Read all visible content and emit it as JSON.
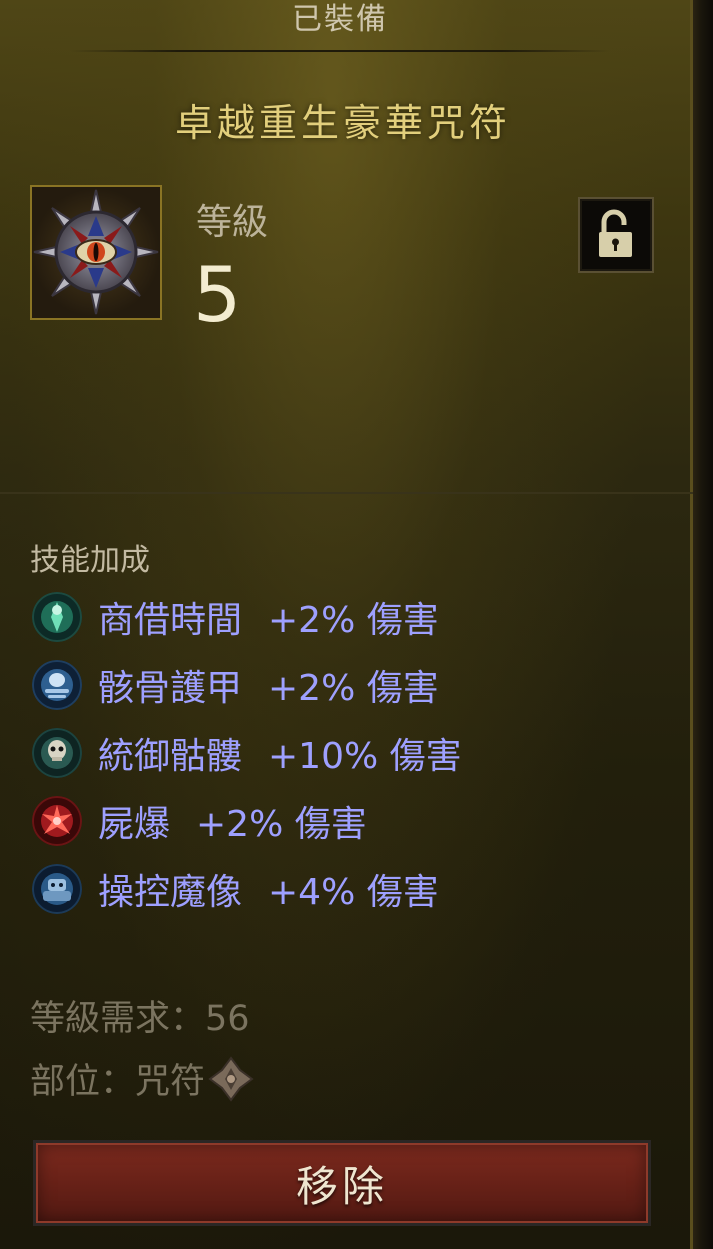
{
  "header": {
    "equipped_label": "已裝備"
  },
  "item": {
    "name": "卓越重生豪華咒符",
    "icon": "eye-charm-icon",
    "level_label": "等級",
    "level_value": "5",
    "lock_icon": "unlocked-padlock-icon"
  },
  "skill_bonus": {
    "section_label": "技能加成",
    "skills": [
      {
        "name": "商借時間",
        "bonus": "+2% 傷害",
        "icon": "borrowed-time-icon",
        "color": "#2aa37a"
      },
      {
        "name": "骸骨護甲",
        "bonus": "+2% 傷害",
        "icon": "bone-armor-icon",
        "color": "#3d7fbf"
      },
      {
        "name": "統御骷髏",
        "bonus": "+10% 傷害",
        "icon": "command-skeletons-icon",
        "color": "#3a8a7a"
      },
      {
        "name": "屍爆",
        "bonus": "+2% 傷害",
        "icon": "corpse-explosion-icon",
        "color": "#c2282c"
      },
      {
        "name": "操控魔像",
        "bonus": "+4% 傷害",
        "icon": "command-golem-icon",
        "color": "#2f6fa5"
      }
    ]
  },
  "requirements": {
    "level_req": "等級需求：56",
    "slot": "部位：咒符",
    "slot_icon": "charm-slot-icon"
  },
  "actions": {
    "remove_label": "移除"
  },
  "colors": {
    "skill_text": "#9ea0ff",
    "item_name": "#e2cf7c",
    "remove_button": "#6a2218"
  }
}
